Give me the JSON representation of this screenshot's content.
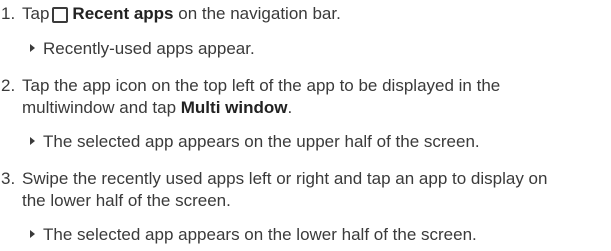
{
  "steps": [
    {
      "number": "1.",
      "pre": "Tap",
      "icon": "recent-apps-icon",
      "bold": "Recent apps",
      "post": " on the navigation bar.",
      "result": "Recently-used apps appear."
    },
    {
      "number": "2.",
      "line1": "Tap the app icon on the top left of the app to be displayed in the",
      "line2_pre": "multiwindow and tap ",
      "line2_bold": "Multi window",
      "line2_post": ".",
      "result": "The selected app appears on the upper half of the screen."
    },
    {
      "number": "3.",
      "line1": "Swipe the recently used apps left or right and tap an app to display on",
      "line2": "the lower half of the screen.",
      "result": "The selected app appears on the lower half of the screen."
    }
  ]
}
